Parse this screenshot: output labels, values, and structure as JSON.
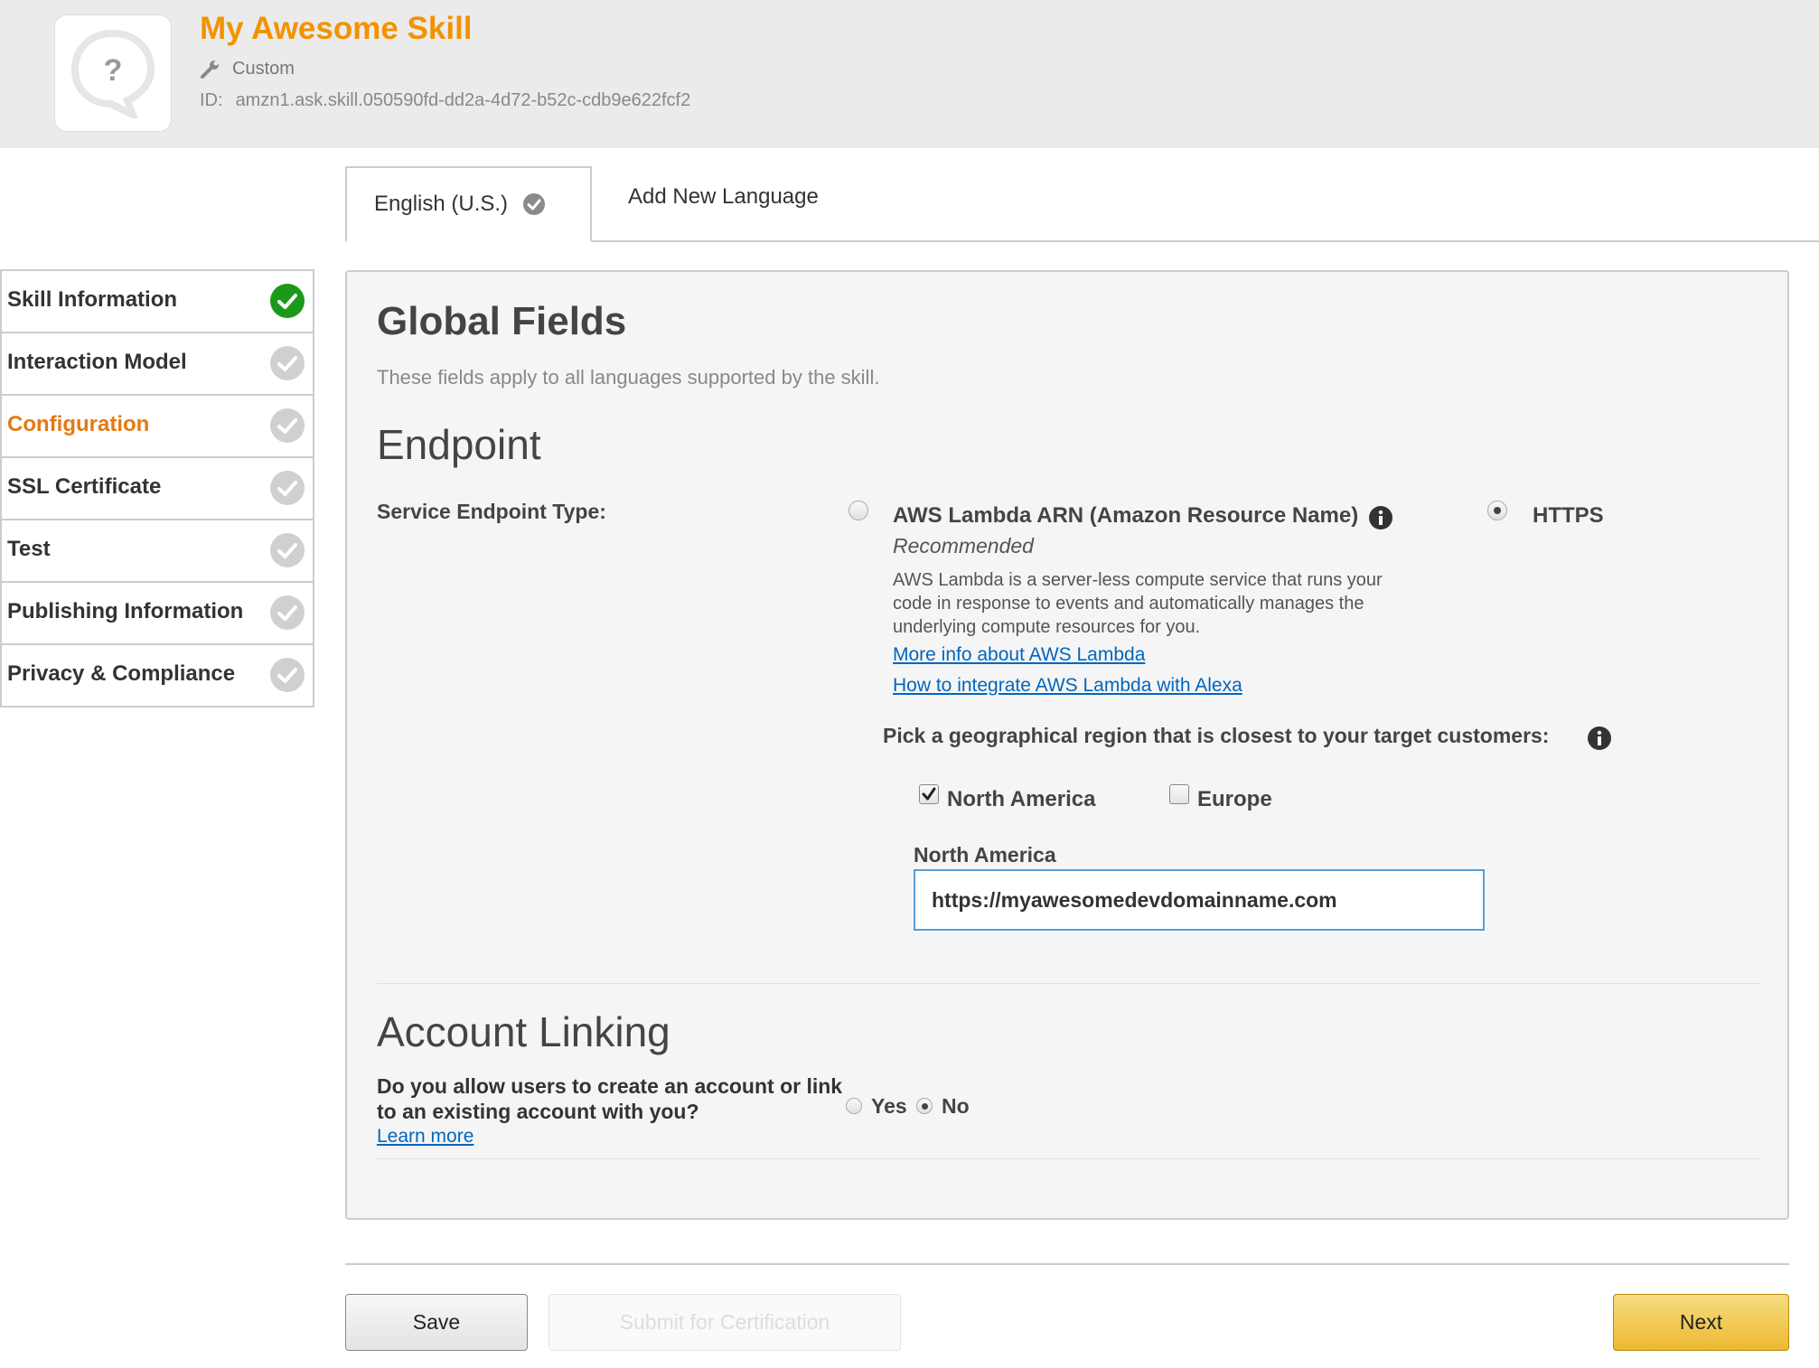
{
  "header": {
    "skill_name": "My Awesome Skill",
    "skill_type": "Custom",
    "id_label": "ID:",
    "id_value": "amzn1.ask.skill.050590fd-dd2a-4d72-b52c-cdb9e622fcf2"
  },
  "tabs": [
    {
      "label": "English (U.S.)",
      "active": true
    },
    {
      "label": "Add New Language",
      "active": false
    }
  ],
  "sidebar": {
    "items": [
      {
        "label": "Skill Information",
        "status": "complete"
      },
      {
        "label": "Interaction Model",
        "status": "pending"
      },
      {
        "label": "Configuration",
        "status": "pending",
        "active": true
      },
      {
        "label": "SSL Certificate",
        "status": "pending"
      },
      {
        "label": "Test",
        "status": "pending"
      },
      {
        "label": "Publishing Information",
        "status": "pending"
      },
      {
        "label": "Privacy & Compliance",
        "status": "pending"
      }
    ]
  },
  "main": {
    "global_title": "Global Fields",
    "global_subtitle": "These fields apply to all languages supported by the skill.",
    "endpoint": {
      "title": "Endpoint",
      "type_label": "Service Endpoint Type:",
      "lambda_option": "AWS Lambda ARN (Amazon Resource Name)",
      "lambda_selected": false,
      "recommended": "Recommended",
      "lambda_description": "AWS Lambda is a server-less compute service that runs your code in response to events and automatically manages the underlying compute resources for you.",
      "link_more_info": "More info about AWS Lambda",
      "link_integrate": "How to integrate AWS Lambda with Alexa",
      "https_option": "HTTPS",
      "https_selected": true,
      "region_prompt": "Pick a geographical region that is closest to your target customers:",
      "regions": [
        {
          "label": "North America",
          "checked": true
        },
        {
          "label": "Europe",
          "checked": false
        }
      ],
      "na_field_label": "North America",
      "na_url": "https://myawesomedevdomainname.com"
    },
    "account_linking": {
      "title": "Account Linking",
      "question": "Do you allow users to create an account or link to an existing account with you?",
      "learn_more": "Learn more",
      "yes_label": "Yes",
      "no_label": "No",
      "selected": "No"
    }
  },
  "footer": {
    "save": "Save",
    "submit": "Submit for Certification",
    "next": "Next"
  },
  "colors": {
    "brand_orange": "#f39200",
    "active_nav": "#e47911",
    "complete_green": "#1a9a1a",
    "link_blue": "#0066c0"
  }
}
